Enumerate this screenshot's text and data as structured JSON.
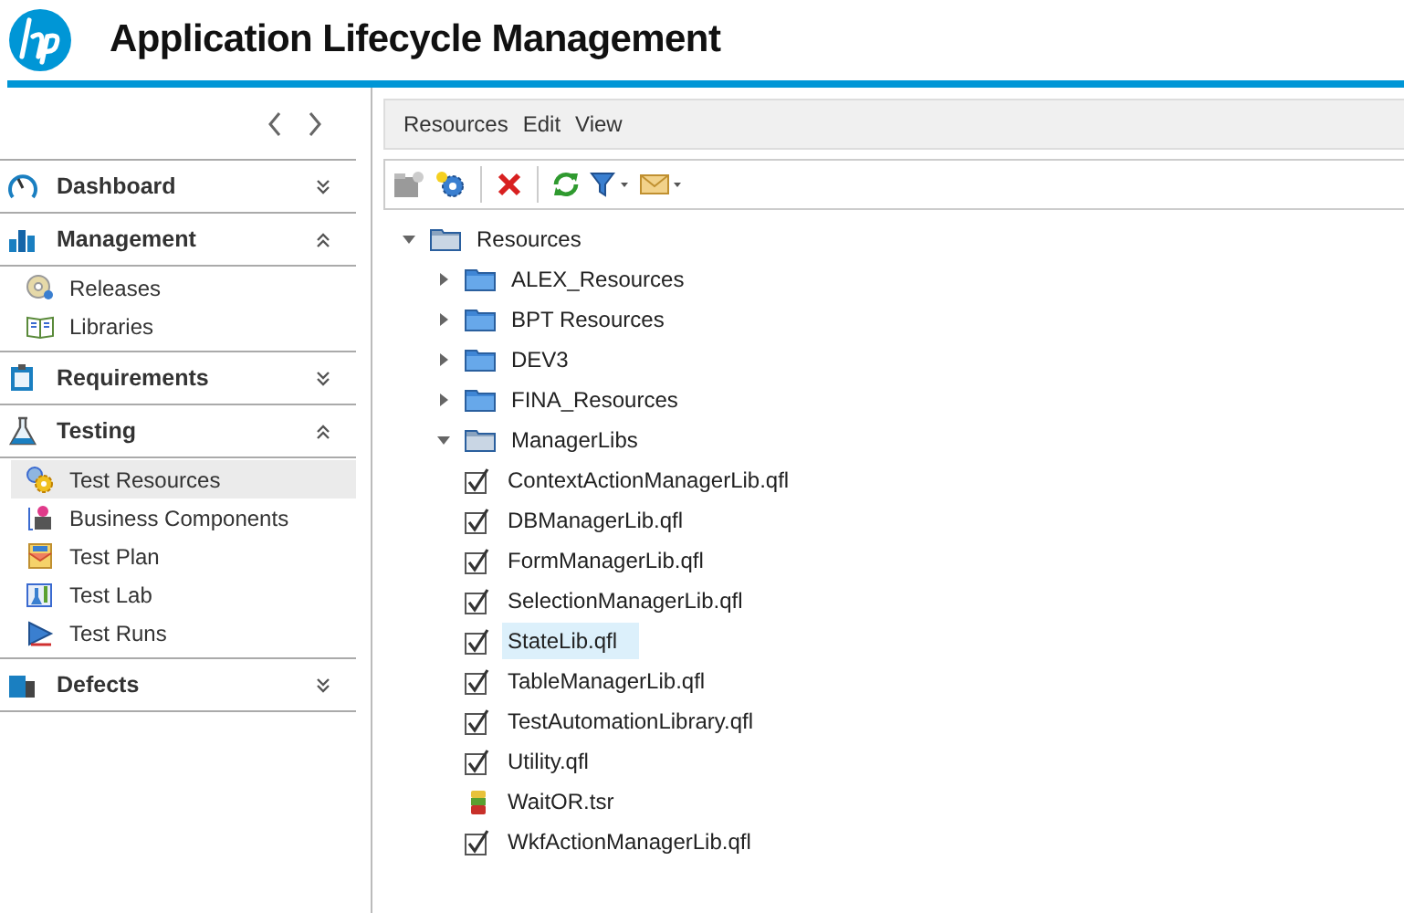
{
  "header": {
    "title": "Application Lifecycle Management"
  },
  "sidebar": {
    "modules": [
      {
        "label": "Dashboard",
        "expanded": false
      },
      {
        "label": "Management",
        "expanded": true,
        "items": [
          {
            "label": "Releases",
            "selected": false
          },
          {
            "label": "Libraries",
            "selected": false
          }
        ]
      },
      {
        "label": "Requirements",
        "expanded": false
      },
      {
        "label": "Testing",
        "expanded": true,
        "items": [
          {
            "label": "Test Resources",
            "selected": true
          },
          {
            "label": "Business Components",
            "selected": false
          },
          {
            "label": "Test Plan",
            "selected": false
          },
          {
            "label": "Test Lab",
            "selected": false
          },
          {
            "label": "Test Runs",
            "selected": false
          }
        ]
      },
      {
        "label": "Defects",
        "expanded": false
      }
    ]
  },
  "menu_bar": [
    "Resources",
    "Edit",
    "View"
  ],
  "tree": {
    "label": "Resources",
    "kind": "folder",
    "expanded": true,
    "selected": false,
    "children": [
      {
        "label": "ALEX_Resources",
        "kind": "folder",
        "expanded": false,
        "selected": false
      },
      {
        "label": "BPT Resources",
        "kind": "folder",
        "expanded": false,
        "selected": false
      },
      {
        "label": "DEV3",
        "kind": "folder",
        "expanded": false,
        "selected": false
      },
      {
        "label": "FINA_Resources",
        "kind": "folder",
        "expanded": false,
        "selected": false
      },
      {
        "label": "ManagerLibs",
        "kind": "folder",
        "expanded": true,
        "selected": false,
        "children": [
          {
            "label": "ContextActionManagerLib.qfl",
            "kind": "library",
            "selected": false
          },
          {
            "label": "DBManagerLib.qfl",
            "kind": "library",
            "selected": false
          },
          {
            "label": "FormManagerLib.qfl",
            "kind": "library",
            "selected": false
          },
          {
            "label": "SelectionManagerLib.qfl",
            "kind": "library",
            "selected": false
          },
          {
            "label": "StateLib.qfl",
            "kind": "library",
            "selected": true
          },
          {
            "label": "TableManagerLib.qfl",
            "kind": "library",
            "selected": false
          },
          {
            "label": "TestAutomationLibrary.qfl",
            "kind": "library",
            "selected": false
          },
          {
            "label": "Utility.qfl",
            "kind": "library",
            "selected": false
          },
          {
            "label": "WaitOR.tsr",
            "kind": "recovery",
            "selected": false
          },
          {
            "label": "WkfActionManagerLib.qfl",
            "kind": "library",
            "selected": false
          }
        ]
      }
    ]
  }
}
